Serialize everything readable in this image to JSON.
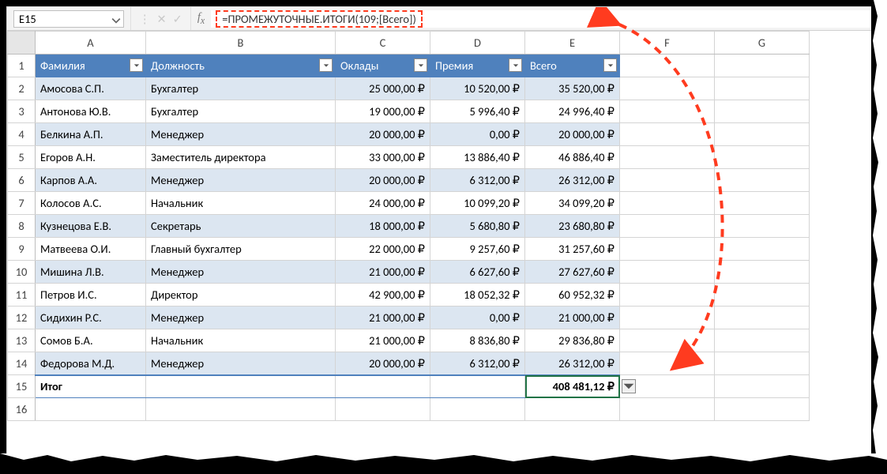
{
  "namebox": {
    "value": "E15"
  },
  "formula": {
    "value": "=ПРОМЕЖУТОЧНЫЕ.ИТОГИ(109;[Всего])"
  },
  "cols": {
    "A": "A",
    "B": "B",
    "C": "C",
    "D": "D",
    "E": "E",
    "F": "F",
    "G": "G"
  },
  "headers": {
    "A": "Фамилия",
    "B": "Должность",
    "C": "Оклады",
    "D": "Премия",
    "E": "Всего"
  },
  "rows": [
    {
      "n": "2",
      "A": "Амосова С.П.",
      "B": "Бухгалтер",
      "C": "25 000,00 ₽",
      "D": "10 520,00 ₽",
      "E": "35 520,00 ₽"
    },
    {
      "n": "3",
      "A": "Антонова Ю.В.",
      "B": "Бухгалтер",
      "C": "19 000,00 ₽",
      "D": "5 996,40 ₽",
      "E": "24 996,40 ₽"
    },
    {
      "n": "4",
      "A": "Белкина А.П.",
      "B": "Менеджер",
      "C": "20 000,00 ₽",
      "D": "0,00 ₽",
      "E": "20 000,00 ₽"
    },
    {
      "n": "5",
      "A": "Егоров А.Н.",
      "B": "Заместитель директора",
      "C": "33 000,00 ₽",
      "D": "13 886,40 ₽",
      "E": "46 886,40 ₽"
    },
    {
      "n": "6",
      "A": "Карпов А.А.",
      "B": "Менеджер",
      "C": "20 000,00 ₽",
      "D": "6 312,00 ₽",
      "E": "26 312,00 ₽"
    },
    {
      "n": "7",
      "A": "Колосов А.С.",
      "B": "Начальник",
      "C": "24 000,00 ₽",
      "D": "10 099,20 ₽",
      "E": "34 099,20 ₽"
    },
    {
      "n": "8",
      "A": "Кузнецова Е.В.",
      "B": "Секретарь",
      "C": "18 000,00 ₽",
      "D": "5 680,80 ₽",
      "E": "23 680,80 ₽"
    },
    {
      "n": "9",
      "A": "Матвеева О.И.",
      "B": "Главный бухгалтер",
      "C": "22 000,00 ₽",
      "D": "9 257,60 ₽",
      "E": "31 257,60 ₽"
    },
    {
      "n": "10",
      "A": "Мишина Л.В.",
      "B": "Менеджер",
      "C": "21 000,00 ₽",
      "D": "6 627,60 ₽",
      "E": "27 627,60 ₽"
    },
    {
      "n": "11",
      "A": "Петров И.С.",
      "B": "Директор",
      "C": "42 900,00 ₽",
      "D": "18 052,32 ₽",
      "E": "60 952,32 ₽"
    },
    {
      "n": "12",
      "A": "Сидихин Р.С.",
      "B": "Менеджер",
      "C": "21 000,00 ₽",
      "D": "0,00 ₽",
      "E": "21 000,00 ₽"
    },
    {
      "n": "13",
      "A": "Сомов Б.А.",
      "B": "Начальник",
      "C": "21 000,00 ₽",
      "D": "8 836,80 ₽",
      "E": "29 836,80 ₽"
    },
    {
      "n": "14",
      "A": "Федорова М.Д.",
      "B": "Менеджер",
      "C": "20 000,00 ₽",
      "D": "6 312,00 ₽",
      "E": "26 312,00 ₽"
    }
  ],
  "total": {
    "n": "15",
    "label": "Итог",
    "value": "408 481,12 ₽"
  },
  "extra_row": "16"
}
